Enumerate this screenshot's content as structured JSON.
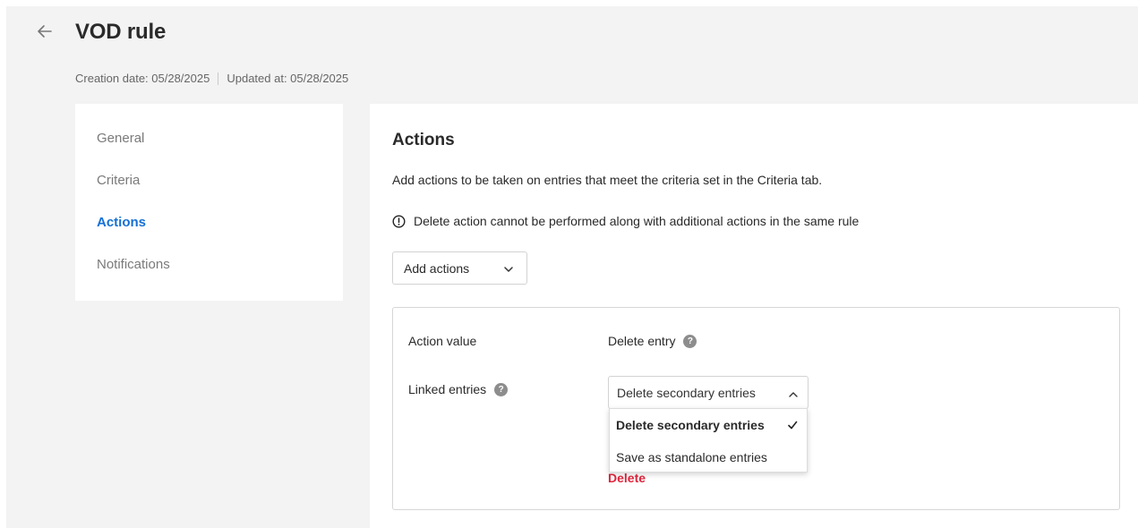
{
  "header": {
    "title": "VOD rule",
    "creation_date": "Creation date: 05/28/2025",
    "updated_at": "Updated at: 05/28/2025"
  },
  "sidebar": {
    "items": [
      {
        "label": "General",
        "active": false
      },
      {
        "label": "Criteria",
        "active": false
      },
      {
        "label": "Actions",
        "active": true
      },
      {
        "label": "Notifications",
        "active": false
      }
    ]
  },
  "main": {
    "title": "Actions",
    "description": "Add actions to be taken on entries that meet the criteria set in the Criteria tab.",
    "warning": "Delete action cannot be performed along with additional actions in the same rule",
    "add_actions_label": "Add actions",
    "card": {
      "action_value_label": "Action value",
      "action_value": "Delete entry",
      "linked_entries_label": "Linked entries",
      "linked_entries_selected": "Delete secondary entries",
      "delete_label": "Delete"
    }
  },
  "dropdown": {
    "options": [
      {
        "label": "Delete secondary entries",
        "selected": true
      },
      {
        "label": "Save as standalone entries",
        "selected": false
      }
    ]
  },
  "colors": {
    "accent": "#1470d6",
    "danger": "#e0263d",
    "background": "#f3f3f3"
  },
  "icons": {
    "back": "arrow-left-icon",
    "warning": "exclamation-circle-icon",
    "help": "question-circle-icon",
    "chevron_down": "chevron-down-icon",
    "chevron_up": "chevron-up-icon",
    "check": "check-icon"
  }
}
